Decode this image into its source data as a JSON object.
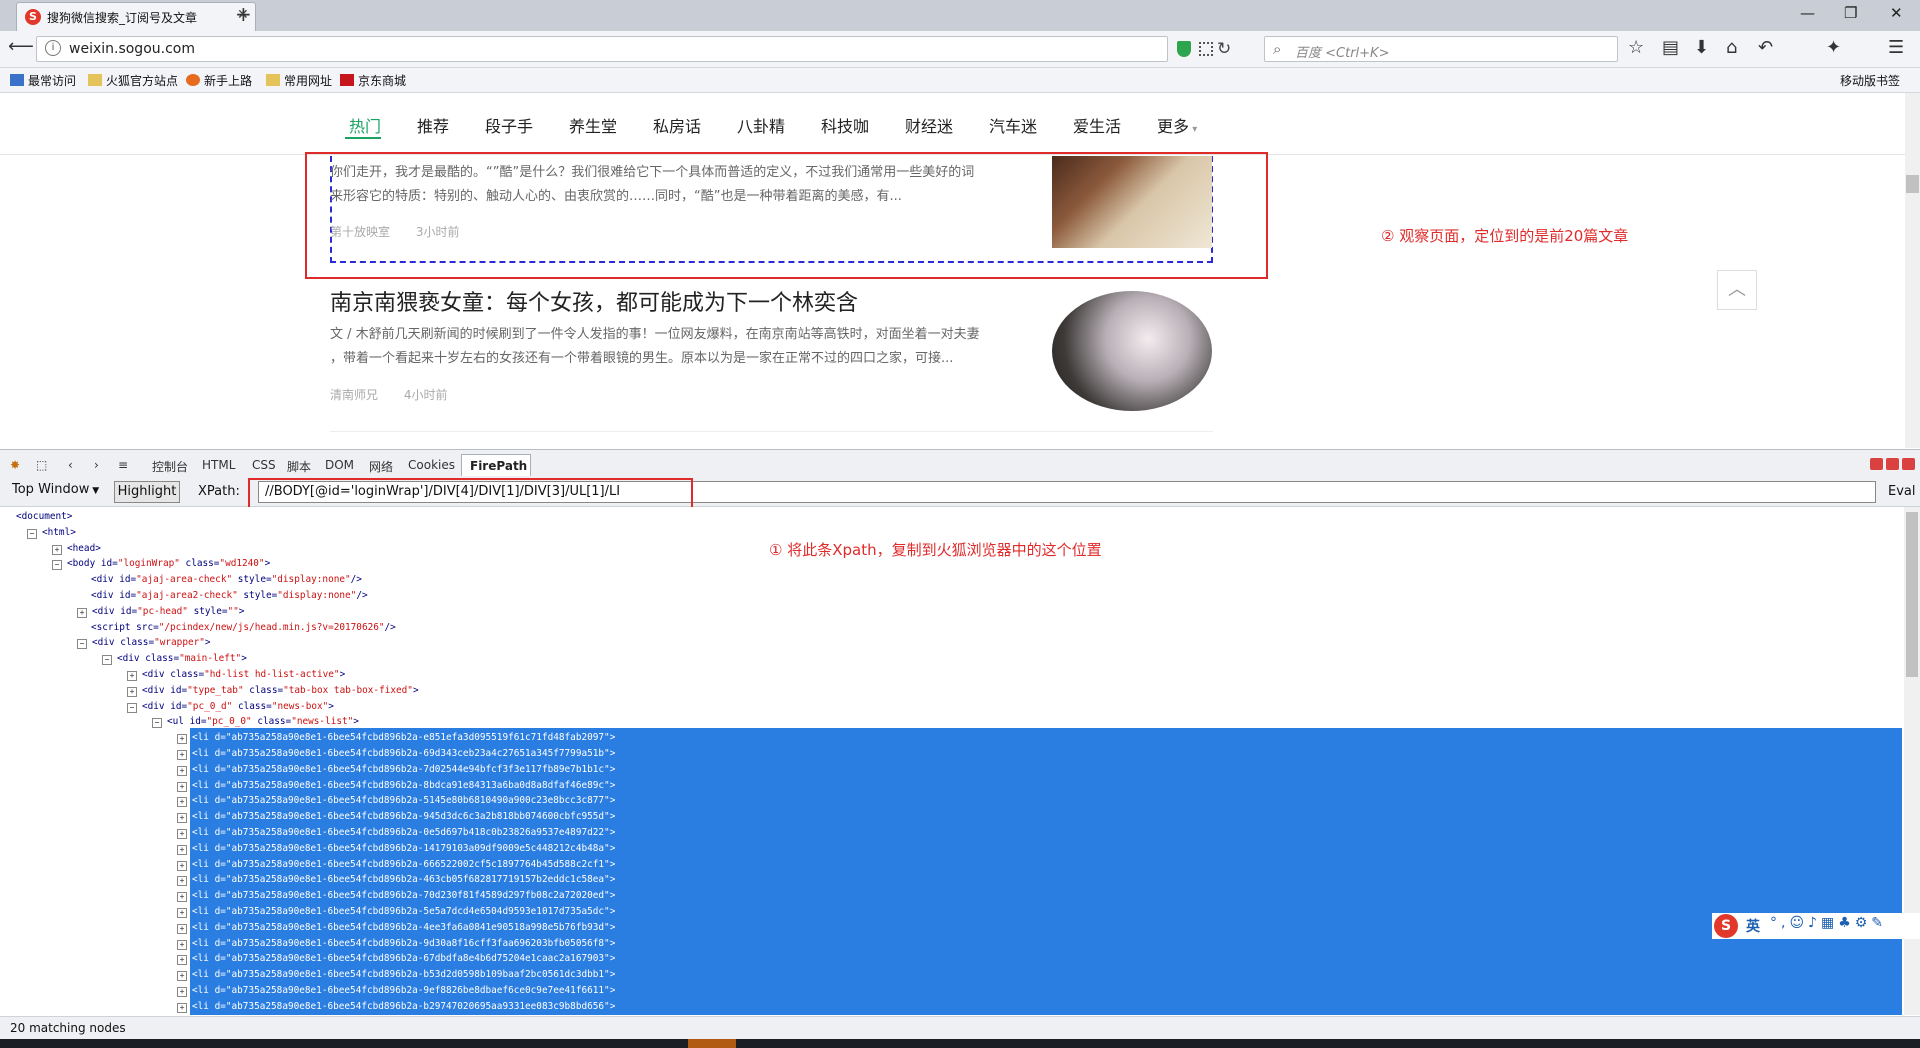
{
  "browser": {
    "tab_title": "搜狗微信搜索_订阅号及文章",
    "tab_favicon": "S",
    "url": "weixin.sogou.com",
    "search_placeholder": "百度 <Ctrl+K>",
    "bookmarks": [
      "最常访问",
      "火狐官方站点",
      "新手上路",
      "常用网址",
      "京东商城"
    ],
    "mobile_bookmarks": "移动版书签"
  },
  "page": {
    "categories": [
      "热门",
      "推荐",
      "段子手",
      "养生堂",
      "私房话",
      "八卦精",
      "科技咖",
      "财经迷",
      "汽车迷",
      "爱生活",
      "更多"
    ],
    "active_category": "热门",
    "article1": {
      "summary_line1": "你们走开，我才是最酷的。“”酷”是什么？我们很难给它下一个具体而普适的定义，不过我们通常用一些美好的词",
      "summary_line2": "来形容它的特质：特别的、触动人心的、由衷欣赏的……同时，“酷”也是一种带着距离的美感，有...",
      "source": "第十放映室",
      "time": "3小时前"
    },
    "article2": {
      "title": "南京南猥亵女童：每个女孩，都可能成为下一个林奕含",
      "summary_line1": "文 / 木舒前几天刷新闻的时候刷到了一件令人发指的事！一位网友爆料，在南京南站等高铁时，对面坐着一对夫妻",
      "summary_line2": "，带着一个看起来十岁左右的女孩还有一个带着眼镜的男生。原本以为是一家在正常不过的四口之家，可接...",
      "source": "清南师兄",
      "time": "4小时前"
    },
    "annotation_2": "② 观察页面，定位到的是前20篇文章"
  },
  "firebug": {
    "tabs": [
      "控制台",
      "HTML",
      "CSS",
      "脚本",
      "DOM",
      "网络",
      "Cookies"
    ],
    "active_tab": "FirePath",
    "window_select": "Top Window",
    "highlight_label": "Highlight",
    "xpath_label": "XPath:",
    "xpath_value": "//BODY[@id='loginWrap']/DIV[4]/DIV[1]/DIV[3]/UL[1]/LI",
    "eval_label": "Eval",
    "annotation_1": "① 将此条Xpath，复制到火狐浏览器中的这个位置",
    "status": "20 matching nodes",
    "ime_mode": "英",
    "tree": [
      {
        "indent": 0,
        "toggle": "",
        "text": "<document>"
      },
      {
        "indent": 1,
        "toggle": "−",
        "text": "<html>"
      },
      {
        "indent": 2,
        "toggle": "+",
        "text": "<head>"
      },
      {
        "indent": 2,
        "toggle": "−",
        "tag": "<body",
        "attrs": [
          [
            "id",
            "loginWrap"
          ],
          [
            "class",
            "wd1240"
          ]
        ],
        "close": ">"
      },
      {
        "indent": 3,
        "toggle": "",
        "tag": "<div",
        "attrs": [
          [
            "id",
            "ajaj-area-check"
          ],
          [
            "style",
            "display:none"
          ]
        ],
        "close": "/>"
      },
      {
        "indent": 3,
        "toggle": "",
        "tag": "<div",
        "attrs": [
          [
            "id",
            "ajaj-area2-check"
          ],
          [
            "style",
            "display:none"
          ]
        ],
        "close": "/>"
      },
      {
        "indent": 3,
        "toggle": "+",
        "tag": "<div",
        "attrs": [
          [
            "id",
            "pc-head"
          ],
          [
            "style",
            ""
          ]
        ],
        "close": ">"
      },
      {
        "indent": 3,
        "toggle": "",
        "tag": "<script",
        "attrs": [
          [
            "src",
            "/pcindex/new/js/head.min.js?v=20170626"
          ]
        ],
        "close": "/>"
      },
      {
        "indent": 3,
        "toggle": "−",
        "tag": "<div",
        "attrs": [
          [
            "class",
            "wrapper"
          ]
        ],
        "close": ">"
      },
      {
        "indent": 4,
        "toggle": "−",
        "tag": "<div",
        "attrs": [
          [
            "class",
            "main-left"
          ]
        ],
        "close": ">"
      },
      {
        "indent": 5,
        "toggle": "+",
        "tag": "<div",
        "attrs": [
          [
            "class",
            "hd-list hd-list-active"
          ]
        ],
        "close": ">"
      },
      {
        "indent": 5,
        "toggle": "+",
        "tag": "<div",
        "attrs": [
          [
            "id",
            "type_tab"
          ],
          [
            "class",
            "tab-box tab-box-fixed"
          ]
        ],
        "close": ">"
      },
      {
        "indent": 5,
        "toggle": "−",
        "tag": "<div",
        "attrs": [
          [
            "id",
            "pc_0_d"
          ],
          [
            "class",
            "news-box"
          ]
        ],
        "close": ">"
      },
      {
        "indent": 6,
        "toggle": "−",
        "tag": "<ul",
        "attrs": [
          [
            "id",
            "pc_0_0"
          ],
          [
            "class",
            "news-list"
          ]
        ],
        "close": ">"
      },
      {
        "indent": 7,
        "toggle": "+",
        "sel": true,
        "tag": "<li",
        "attrs": [
          [
            "d",
            "ab735a258a90e8e1-6bee54fcbd896b2a-e851efa3d095519f61c71fd48fab2097"
          ]
        ],
        "close": ">"
      },
      {
        "indent": 7,
        "toggle": "+",
        "sel": true,
        "tag": "<li",
        "attrs": [
          [
            "d",
            "ab735a258a90e8e1-6bee54fcbd896b2a-69d343ceb23a4c27651a345f7799a51b"
          ]
        ],
        "close": ">"
      },
      {
        "indent": 7,
        "toggle": "+",
        "sel": true,
        "tag": "<li",
        "attrs": [
          [
            "d",
            "ab735a258a90e8e1-6bee54fcbd896b2a-7d02544e94bfcf3f3e117fb89e7b1b1c"
          ]
        ],
        "close": ">"
      },
      {
        "indent": 7,
        "toggle": "+",
        "sel": true,
        "tag": "<li",
        "attrs": [
          [
            "d",
            "ab735a258a90e8e1-6bee54fcbd896b2a-8bdca91e84313a6ba0d8a8dfaf46e89c"
          ]
        ],
        "close": ">"
      },
      {
        "indent": 7,
        "toggle": "+",
        "sel": true,
        "tag": "<li",
        "attrs": [
          [
            "d",
            "ab735a258a90e8e1-6bee54fcbd896b2a-5145e80b6810490a900c23e8bcc3c877"
          ]
        ],
        "close": ">"
      },
      {
        "indent": 7,
        "toggle": "+",
        "sel": true,
        "tag": "<li",
        "attrs": [
          [
            "d",
            "ab735a258a90e8e1-6bee54fcbd896b2a-945d3dc6c3a2b818bb074600cbfc955d"
          ]
        ],
        "close": ">"
      },
      {
        "indent": 7,
        "toggle": "+",
        "sel": true,
        "tag": "<li",
        "attrs": [
          [
            "d",
            "ab735a258a90e8e1-6bee54fcbd896b2a-0e5d697b418c0b23826a9537e4897d22"
          ]
        ],
        "close": ">"
      },
      {
        "indent": 7,
        "toggle": "+",
        "sel": true,
        "tag": "<li",
        "attrs": [
          [
            "d",
            "ab735a258a90e8e1-6bee54fcbd896b2a-14179103a09df9009e5c448212c4b48a"
          ]
        ],
        "close": ">"
      },
      {
        "indent": 7,
        "toggle": "+",
        "sel": true,
        "tag": "<li",
        "attrs": [
          [
            "d",
            "ab735a258a90e8e1-6bee54fcbd896b2a-666522002cf5c1897764b45d588c2cf1"
          ]
        ],
        "close": ">"
      },
      {
        "indent": 7,
        "toggle": "+",
        "sel": true,
        "tag": "<li",
        "attrs": [
          [
            "d",
            "ab735a258a90e8e1-6bee54fcbd896b2a-463cb05f682817719157b2eddc1c58ea"
          ]
        ],
        "close": ">"
      },
      {
        "indent": 7,
        "toggle": "+",
        "sel": true,
        "tag": "<li",
        "attrs": [
          [
            "d",
            "ab735a258a90e8e1-6bee54fcbd896b2a-70d230f81f4589d297fb08c2a72020ed"
          ]
        ],
        "close": ">"
      },
      {
        "indent": 7,
        "toggle": "+",
        "sel": true,
        "tag": "<li",
        "attrs": [
          [
            "d",
            "ab735a258a90e8e1-6bee54fcbd896b2a-5e5a7dcd4e6504d9593e1017d735a5dc"
          ]
        ],
        "close": ">"
      },
      {
        "indent": 7,
        "toggle": "+",
        "sel": true,
        "tag": "<li",
        "attrs": [
          [
            "d",
            "ab735a258a90e8e1-6bee54fcbd896b2a-4ee3fa6a0841e90518a998e5b76fb93d"
          ]
        ],
        "close": ">"
      },
      {
        "indent": 7,
        "toggle": "+",
        "sel": true,
        "tag": "<li",
        "attrs": [
          [
            "d",
            "ab735a258a90e8e1-6bee54fcbd896b2a-9d30a8f16cff3faa696203bfb05056f8"
          ]
        ],
        "close": ">"
      },
      {
        "indent": 7,
        "toggle": "+",
        "sel": true,
        "tag": "<li",
        "attrs": [
          [
            "d",
            "ab735a258a90e8e1-6bee54fcbd896b2a-67dbdfa8e4b6d75204e1caac2a167903"
          ]
        ],
        "close": ">"
      },
      {
        "indent": 7,
        "toggle": "+",
        "sel": true,
        "tag": "<li",
        "attrs": [
          [
            "d",
            "ab735a258a90e8e1-6bee54fcbd896b2a-b53d2d0598b109baaf2bc0561dc3dbb1"
          ]
        ],
        "close": ">"
      },
      {
        "indent": 7,
        "toggle": "+",
        "sel": true,
        "tag": "<li",
        "attrs": [
          [
            "d",
            "ab735a258a90e8e1-6bee54fcbd896b2a-9ef8826be8dbaef6ce0c9e7ee41f6611"
          ]
        ],
        "close": ">"
      },
      {
        "indent": 7,
        "toggle": "+",
        "sel": true,
        "tag": "<li",
        "attrs": [
          [
            "d",
            "ab735a258a90e8e1-6bee54fcbd896b2a-b29747020695aa9331ee083c9b8bd656"
          ]
        ],
        "close": ">"
      }
    ]
  }
}
